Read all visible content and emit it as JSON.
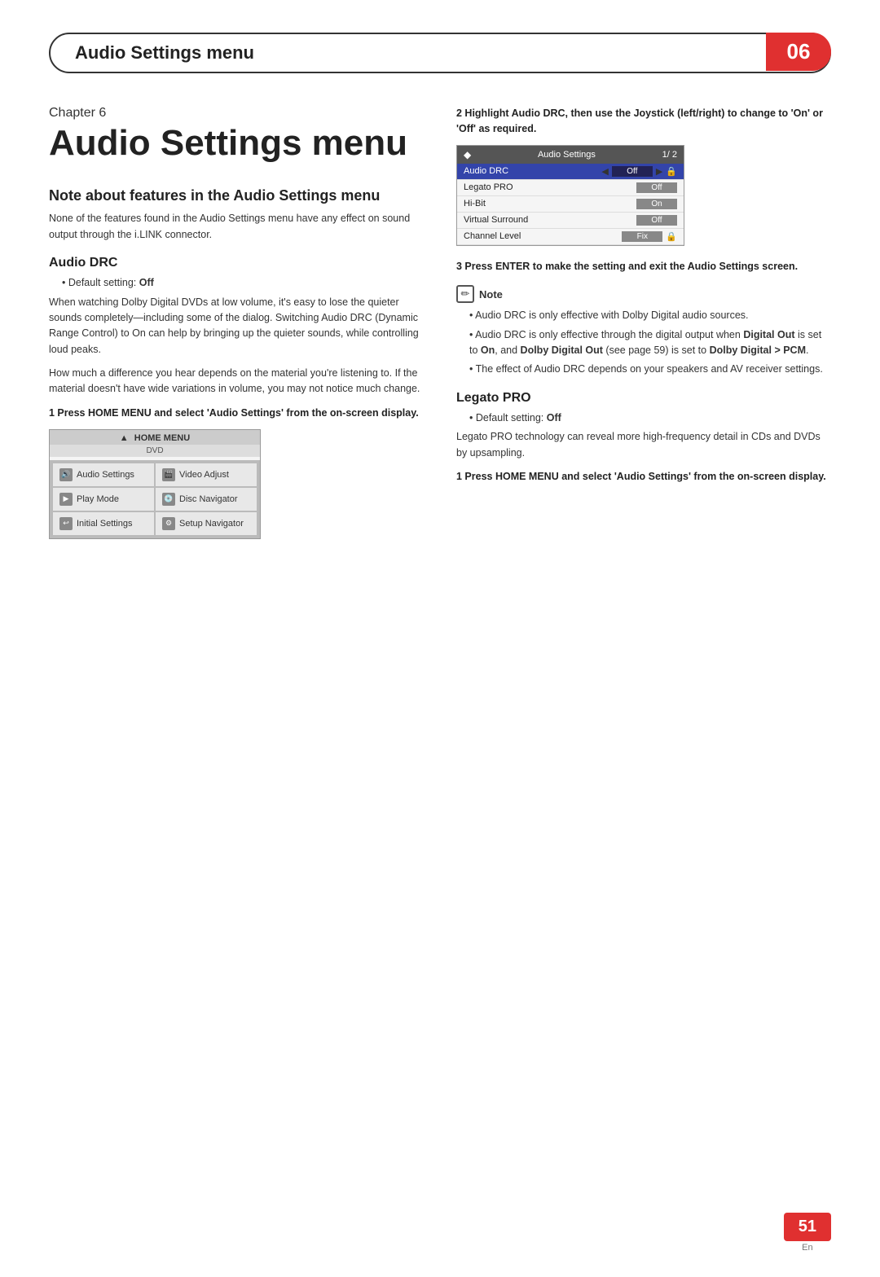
{
  "header": {
    "title": "Audio Settings menu",
    "chapter_number": "06"
  },
  "chapter": {
    "label": "Chapter 6",
    "title": "Audio Settings menu"
  },
  "left_column": {
    "note_heading": "Note about features in the Audio Settings menu",
    "note_body": "None of the features found in the Audio Settings menu have any effect on sound output through the i.LINK connector.",
    "audio_drc": {
      "heading": "Audio DRC",
      "default_setting": "Default setting: Off",
      "body1": "When watching Dolby Digital DVDs at low volume, it's easy to lose the quieter sounds completely—including some of the dialog. Switching Audio DRC (Dynamic Range Control) to On can help by bringing up the quieter sounds, while controlling loud peaks.",
      "body2": "How much a difference you hear depends on the material you're listening to. If the material doesn't have wide variations in volume, you may not notice much change."
    },
    "step1": {
      "text": "1    Press HOME MENU and select 'Audio Settings' from the on-screen display."
    },
    "home_menu": {
      "title": "HOME MENU",
      "subtitle": "DVD",
      "items": [
        {
          "icon": "🔊",
          "label": "Audio Settings"
        },
        {
          "icon": "🎬",
          "label": "Video Adjust"
        },
        {
          "icon": "▶",
          "label": "Play Mode"
        },
        {
          "icon": "💿",
          "label": "Disc Navigator"
        },
        {
          "icon": "↩",
          "label": "Initial Settings"
        },
        {
          "icon": "⚙",
          "label": "Setup Navigator"
        }
      ]
    }
  },
  "right_column": {
    "step2": {
      "text": "2    Highlight Audio DRC, then use the Joystick (left/right) to change to 'On' or 'Off' as required."
    },
    "audio_settings_ui": {
      "header_label": "Audio Settings",
      "header_page": "1/ 2",
      "rows": [
        {
          "name": "Audio DRC",
          "value": "Off",
          "selected": true,
          "has_arrows": true,
          "has_lock": false
        },
        {
          "name": "Legato PRO",
          "value": "Off",
          "selected": false,
          "has_arrows": false,
          "has_lock": false
        },
        {
          "name": "Hi-Bit",
          "value": "On",
          "selected": false,
          "has_arrows": false,
          "has_lock": false
        },
        {
          "name": "Virtual Surround",
          "value": "Off",
          "selected": false,
          "has_arrows": false,
          "has_lock": false
        },
        {
          "name": "Channel Level",
          "value": "Fix",
          "selected": false,
          "has_arrows": false,
          "has_lock": true
        }
      ]
    },
    "step3": {
      "text": "3    Press ENTER to make the setting and exit the Audio Settings screen."
    },
    "note": {
      "label": "Note",
      "bullets": [
        "Audio DRC is only effective with Dolby Digital audio sources.",
        "Audio DRC is only effective through the digital output when Digital Out is set to On, and Dolby Digital Out (see page 59) is set to Dolby Digital > PCM.",
        "The effect of Audio DRC depends on your speakers and AV receiver settings."
      ]
    },
    "legato_pro": {
      "heading": "Legato PRO",
      "default_setting": "Default setting: Off",
      "body": "Legato PRO technology can reveal more high-frequency detail in CDs and DVDs by upsampling.",
      "step1": "1    Press HOME MENU and select 'Audio Settings' from the on-screen display."
    }
  },
  "footer": {
    "page_number": "51",
    "lang": "En"
  }
}
